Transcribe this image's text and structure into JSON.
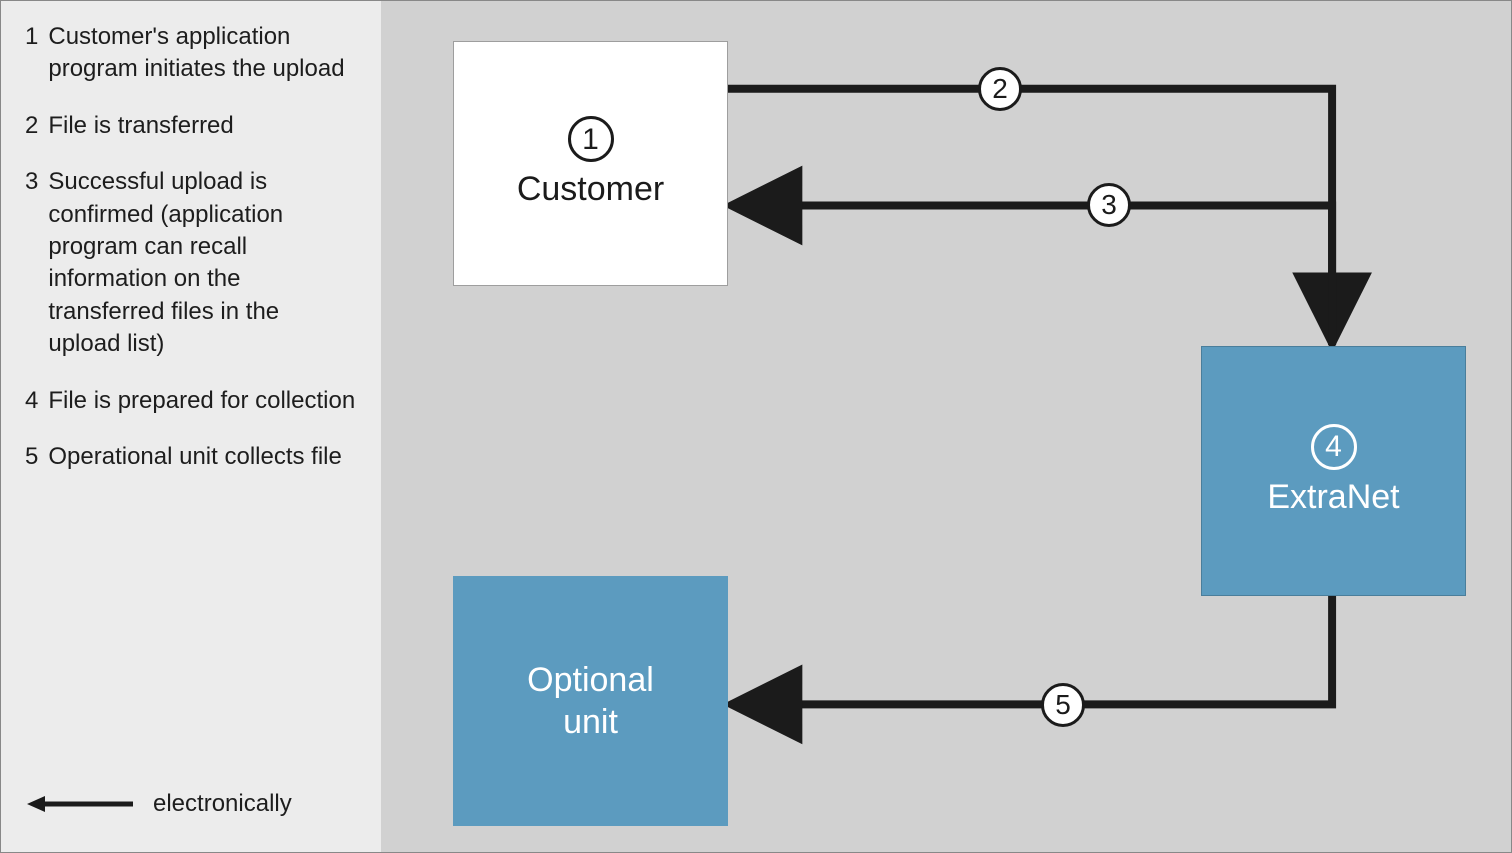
{
  "legend": {
    "items": [
      {
        "num": "1",
        "text": "Customer's application program initiates the upload"
      },
      {
        "num": "2",
        "text": "File is transferred"
      },
      {
        "num": "3",
        "text": "Successful upload is confirmed (application program can recall information on the transferred files in the upload list)"
      },
      {
        "num": "4",
        "text": "File is prepared for collection"
      },
      {
        "num": "5",
        "text": "Operational unit collects file"
      }
    ],
    "arrow_label": "electronically"
  },
  "nodes": {
    "customer": {
      "num": "1",
      "label": "Customer"
    },
    "extranet": {
      "num": "4",
      "label": "ExtraNet"
    },
    "optional": {
      "label_line1": "Optional",
      "label_line2": "unit"
    }
  },
  "path_labels": {
    "p2": "2",
    "p3": "3",
    "p5": "5"
  },
  "colors": {
    "sidebar_bg": "#ececec",
    "diagram_bg": "#d1d1d1",
    "node_blue": "#5c9bbf",
    "stroke": "#1b1b1b"
  }
}
